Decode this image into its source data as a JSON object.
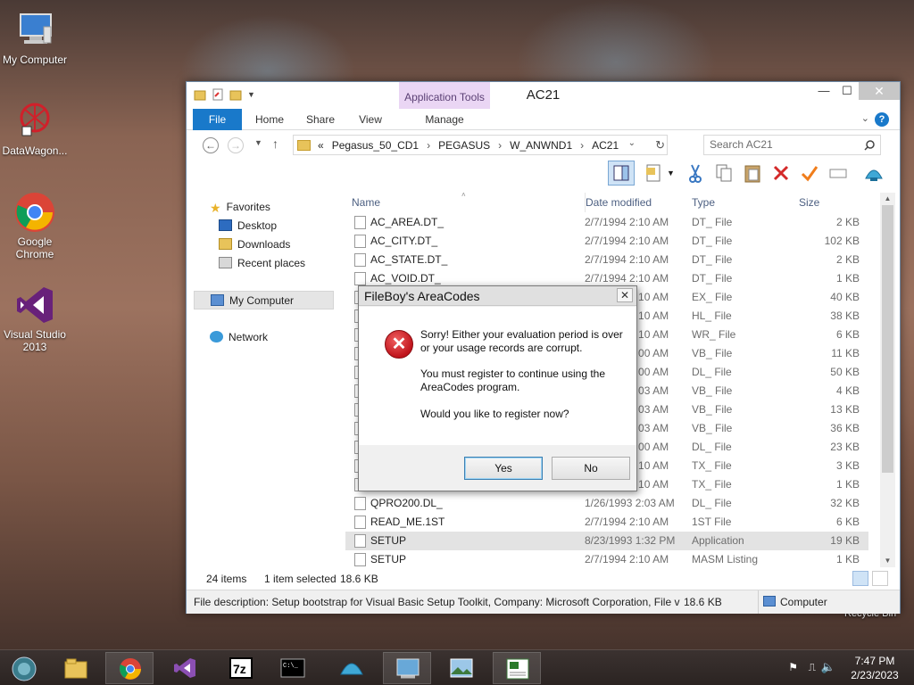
{
  "desktop": {
    "icons": [
      {
        "label": "My Computer"
      },
      {
        "label": "DataWagon..."
      },
      {
        "label": "Google Chrome"
      },
      {
        "label": "Visual Studio 2013"
      }
    ],
    "recycle_bin": "Recycle Bin"
  },
  "explorer": {
    "title": "AC21",
    "contextual_tab_header": "Application Tools",
    "tabs": [
      "File",
      "Home",
      "Share",
      "View",
      "Manage"
    ],
    "address": {
      "overflow": "«",
      "parts": [
        "Pegasus_50_CD1",
        "PEGASUS",
        "W_ANWND1",
        "AC21"
      ]
    },
    "search_placeholder": "Search AC21",
    "nav_pane": {
      "favorites": "Favorites",
      "desktop": "Desktop",
      "downloads": "Downloads",
      "recent": "Recent places",
      "my_computer": "My Computer",
      "network": "Network"
    },
    "columns": {
      "name": "Name",
      "date": "Date modified",
      "type": "Type",
      "size": "Size"
    },
    "rows": [
      {
        "name": "AC_AREA.DT_",
        "date": "2/7/1994 2:10 AM",
        "type": "DT_ File",
        "size": "2 KB"
      },
      {
        "name": "AC_CITY.DT_",
        "date": "2/7/1994 2:10 AM",
        "type": "DT_ File",
        "size": "102 KB"
      },
      {
        "name": "AC_STATE.DT_",
        "date": "2/7/1994 2:10 AM",
        "type": "DT_ File",
        "size": "2 KB"
      },
      {
        "name": "AC_VOID.DT_",
        "date": "2/7/1994 2:10 AM",
        "type": "DT_ File",
        "size": "1 KB"
      },
      {
        "name": "",
        "date": "2/7/1994 2:10 AM",
        "type": "EX_ File",
        "size": "40 KB"
      },
      {
        "name": "",
        "date": "2/7/1994 2:10 AM",
        "type": "HL_ File",
        "size": "38 KB"
      },
      {
        "name": "",
        "date": "2/7/1994 2:10 AM",
        "type": "WR_ File",
        "size": "6 KB"
      },
      {
        "name": "",
        "date": "2/7/1994 2:00 AM",
        "type": "VB_ File",
        "size": "11 KB"
      },
      {
        "name": "",
        "date": "2/7/1994 2:00 AM",
        "type": "DL_ File",
        "size": "50 KB"
      },
      {
        "name": "",
        "date": "2/7/1994 2:03 AM",
        "type": "VB_ File",
        "size": "4 KB"
      },
      {
        "name": "",
        "date": "2/7/1994 2:03 AM",
        "type": "VB_ File",
        "size": "13 KB"
      },
      {
        "name": "",
        "date": "2/7/1994 2:03 AM",
        "type": "VB_ File",
        "size": "36 KB"
      },
      {
        "name": "",
        "date": "2/7/1994 2:00 AM",
        "type": "DL_ File",
        "size": "23 KB"
      },
      {
        "name": "",
        "date": "2/7/1994 2:10 AM",
        "type": "TX_ File",
        "size": "3 KB"
      },
      {
        "name": "",
        "date": "2/7/1994 2:10 AM",
        "type": "TX_ File",
        "size": "1 KB"
      },
      {
        "name": "QPRO200.DL_",
        "date": "1/26/1993 2:03 AM",
        "type": "DL_ File",
        "size": "32 KB"
      },
      {
        "name": "READ_ME.1ST",
        "date": "2/7/1994 2:10 AM",
        "type": "1ST File",
        "size": "6 KB"
      },
      {
        "name": "SETUP",
        "date": "8/23/1993 1:32 PM",
        "type": "Application",
        "size": "19 KB"
      },
      {
        "name": "SETUP",
        "date": "2/7/1994 2:10 AM",
        "type": "MASM Listing",
        "size": "1 KB"
      }
    ],
    "status": {
      "items": "24 items",
      "selected": "1 item selected",
      "selected_size": "18.6 KB",
      "file_description": "File description: Setup bootstrap for Visual Basic Setup Toolkit, Company: Microsoft Corporation, File ve",
      "details_size": "18.6 KB",
      "location": "Computer"
    }
  },
  "dialog": {
    "title": "FileBoy's AreaCodes",
    "close_glyph": "✕",
    "messages": [
      "Sorry! Either your evaluation period is over or your usage records are corrupt.",
      "You must register to continue using the AreaCodes program.",
      "Would you like to register now?"
    ],
    "yes": "Yes",
    "no": "No"
  },
  "taskbar": {
    "time": "7:47 PM",
    "date": "2/23/2023"
  }
}
